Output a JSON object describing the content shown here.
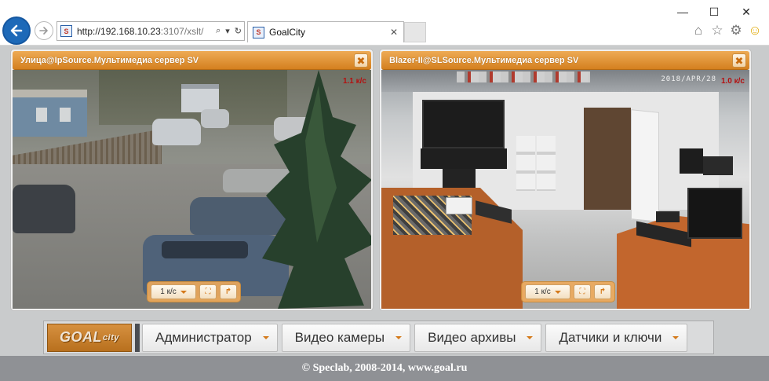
{
  "browser": {
    "url_main": "http://192.168.10.23",
    "url_rest": ":3107/xslt/",
    "tab_title": "GoalCity",
    "site_icon_letter": "S",
    "window_controls": {
      "minimize": "—",
      "maximize": "☐",
      "close": "✕"
    },
    "address_controls": {
      "search": "⌕",
      "dropdown": "▾",
      "refresh": "↻"
    },
    "tab_close": "✕",
    "tool_icons": {
      "home": "⌂",
      "favorites": "☆",
      "settings": "⚙",
      "feedback": "☺"
    }
  },
  "cameras": [
    {
      "title": "Улица@IpSource.Мультимедиа сервер SV",
      "fps": "1.1 к/с",
      "close_label": "✖",
      "speed_label": "1 к/с",
      "fullscreen_icon": "⛶",
      "ptz_icon": "↱"
    },
    {
      "title": "Blazer-II@SLSource.Мультимедиа сервер SV",
      "fps": "1.0 к/с",
      "osd_text": "2018/APR/28",
      "close_label": "✖",
      "speed_label": "1 к/с",
      "fullscreen_icon": "⛶",
      "ptz_icon": "↱"
    }
  ],
  "nav": {
    "brand": "GOAL",
    "brand_suffix": "city",
    "items": [
      {
        "label": "Администратор"
      },
      {
        "label": "Видео камеры"
      },
      {
        "label": "Видео архивы"
      },
      {
        "label": "Датчики и ключи"
      }
    ]
  },
  "footer": {
    "text": "© Speclab, 2008-2014, www.goal.ru"
  },
  "colors": {
    "accent_orange": "#d4801f",
    "back_button": "#1d69b8",
    "fps_red": "#b41010",
    "footer_bg": "#8f9195"
  }
}
